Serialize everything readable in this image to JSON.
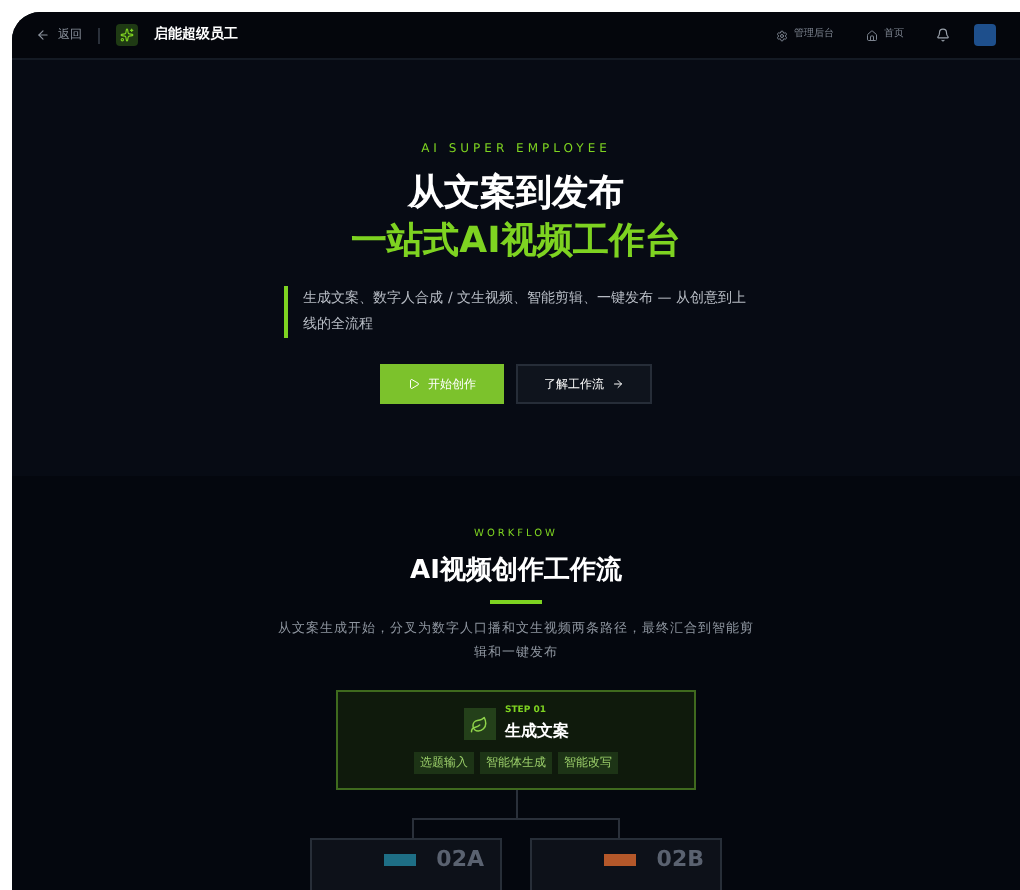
{
  "header": {
    "back": "返回",
    "brand": "启能超级员工",
    "links": [
      "管理后台",
      "首页"
    ]
  },
  "hero": {
    "eyebrow": "AI SUPER EMPLOYEE",
    "title_line1": "从文案到发布",
    "title_line2": "一站式AI视频工作台",
    "description": "生成文案、数字人合成 / 文生视频、智能剪辑、一键发布 — 从创意到上线的全流程",
    "primary_button": "开始创作",
    "secondary_button": "了解工作流"
  },
  "workflow": {
    "eyebrow": "WORKFLOW",
    "title": "AI视频创作工作流",
    "description": "从文案生成开始，分叉为数字人口播和文生视频两条路径，最终汇合到智能剪辑和一键发布",
    "step": {
      "number": "STEP 01",
      "title": "生成文案",
      "tags": [
        "选题输入",
        "智能体生成",
        "智能改写"
      ]
    },
    "branches": [
      {
        "label": "02A",
        "color": "#1e6f86"
      },
      {
        "label": "02B",
        "color": "#b4582a"
      }
    ]
  }
}
